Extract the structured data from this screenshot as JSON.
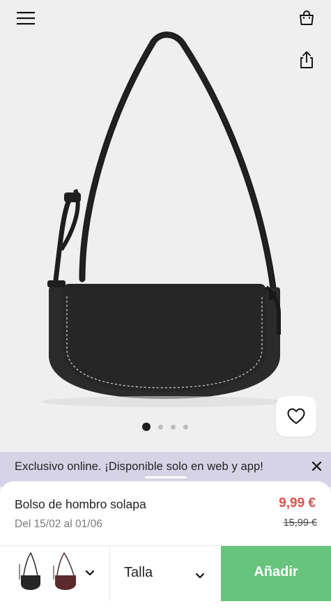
{
  "header": {
    "menu_icon": "hamburger-menu-icon",
    "bag_icon": "shopping-bag-icon",
    "share_icon": "share-icon"
  },
  "gallery": {
    "image": "black-shoulder-bag",
    "favorite_icon": "heart-icon",
    "dots_total": 4,
    "dots_active": 1
  },
  "promo": {
    "text": "Exclusivo online. ¡Disponible solo en web y app!",
    "close_icon": "close-icon",
    "background": "#d6d3e6"
  },
  "product": {
    "name": "Bolso de hombro solapa",
    "dates": "Del 15/02 al 01/06",
    "price": "9,99 €",
    "old_price": "15,99 €",
    "price_color": "#d9534f"
  },
  "actions": {
    "colors": [
      "black",
      "burgundy"
    ],
    "size_label": "Talla",
    "add_label": "Añadir",
    "add_color": "#66c47c"
  }
}
